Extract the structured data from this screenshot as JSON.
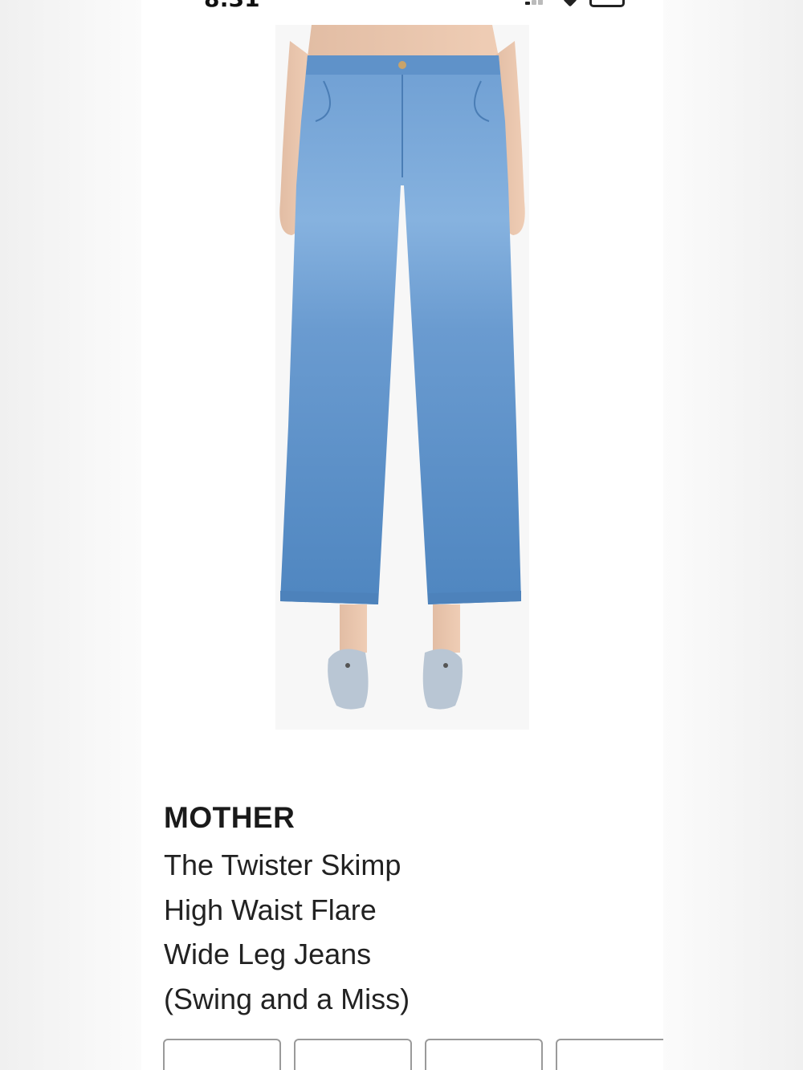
{
  "status_bar": {
    "time": "8:31"
  },
  "product": {
    "image_alt": "Model wearing wide leg light-wash flare jeans with denim heeled sandals",
    "brand": "MOTHER",
    "name": "The Twister Skimp High Waist Flare Wide Leg Jeans (Swing and a Miss)"
  },
  "option_buttons": [
    {
      "label": ""
    },
    {
      "label": ""
    },
    {
      "label": ""
    },
    {
      "label": ""
    }
  ],
  "colors": {
    "page_background": "#f2f2f2",
    "card_background": "#ffffff",
    "denim": "#5b8ec4",
    "text": "#1a1a1a"
  }
}
